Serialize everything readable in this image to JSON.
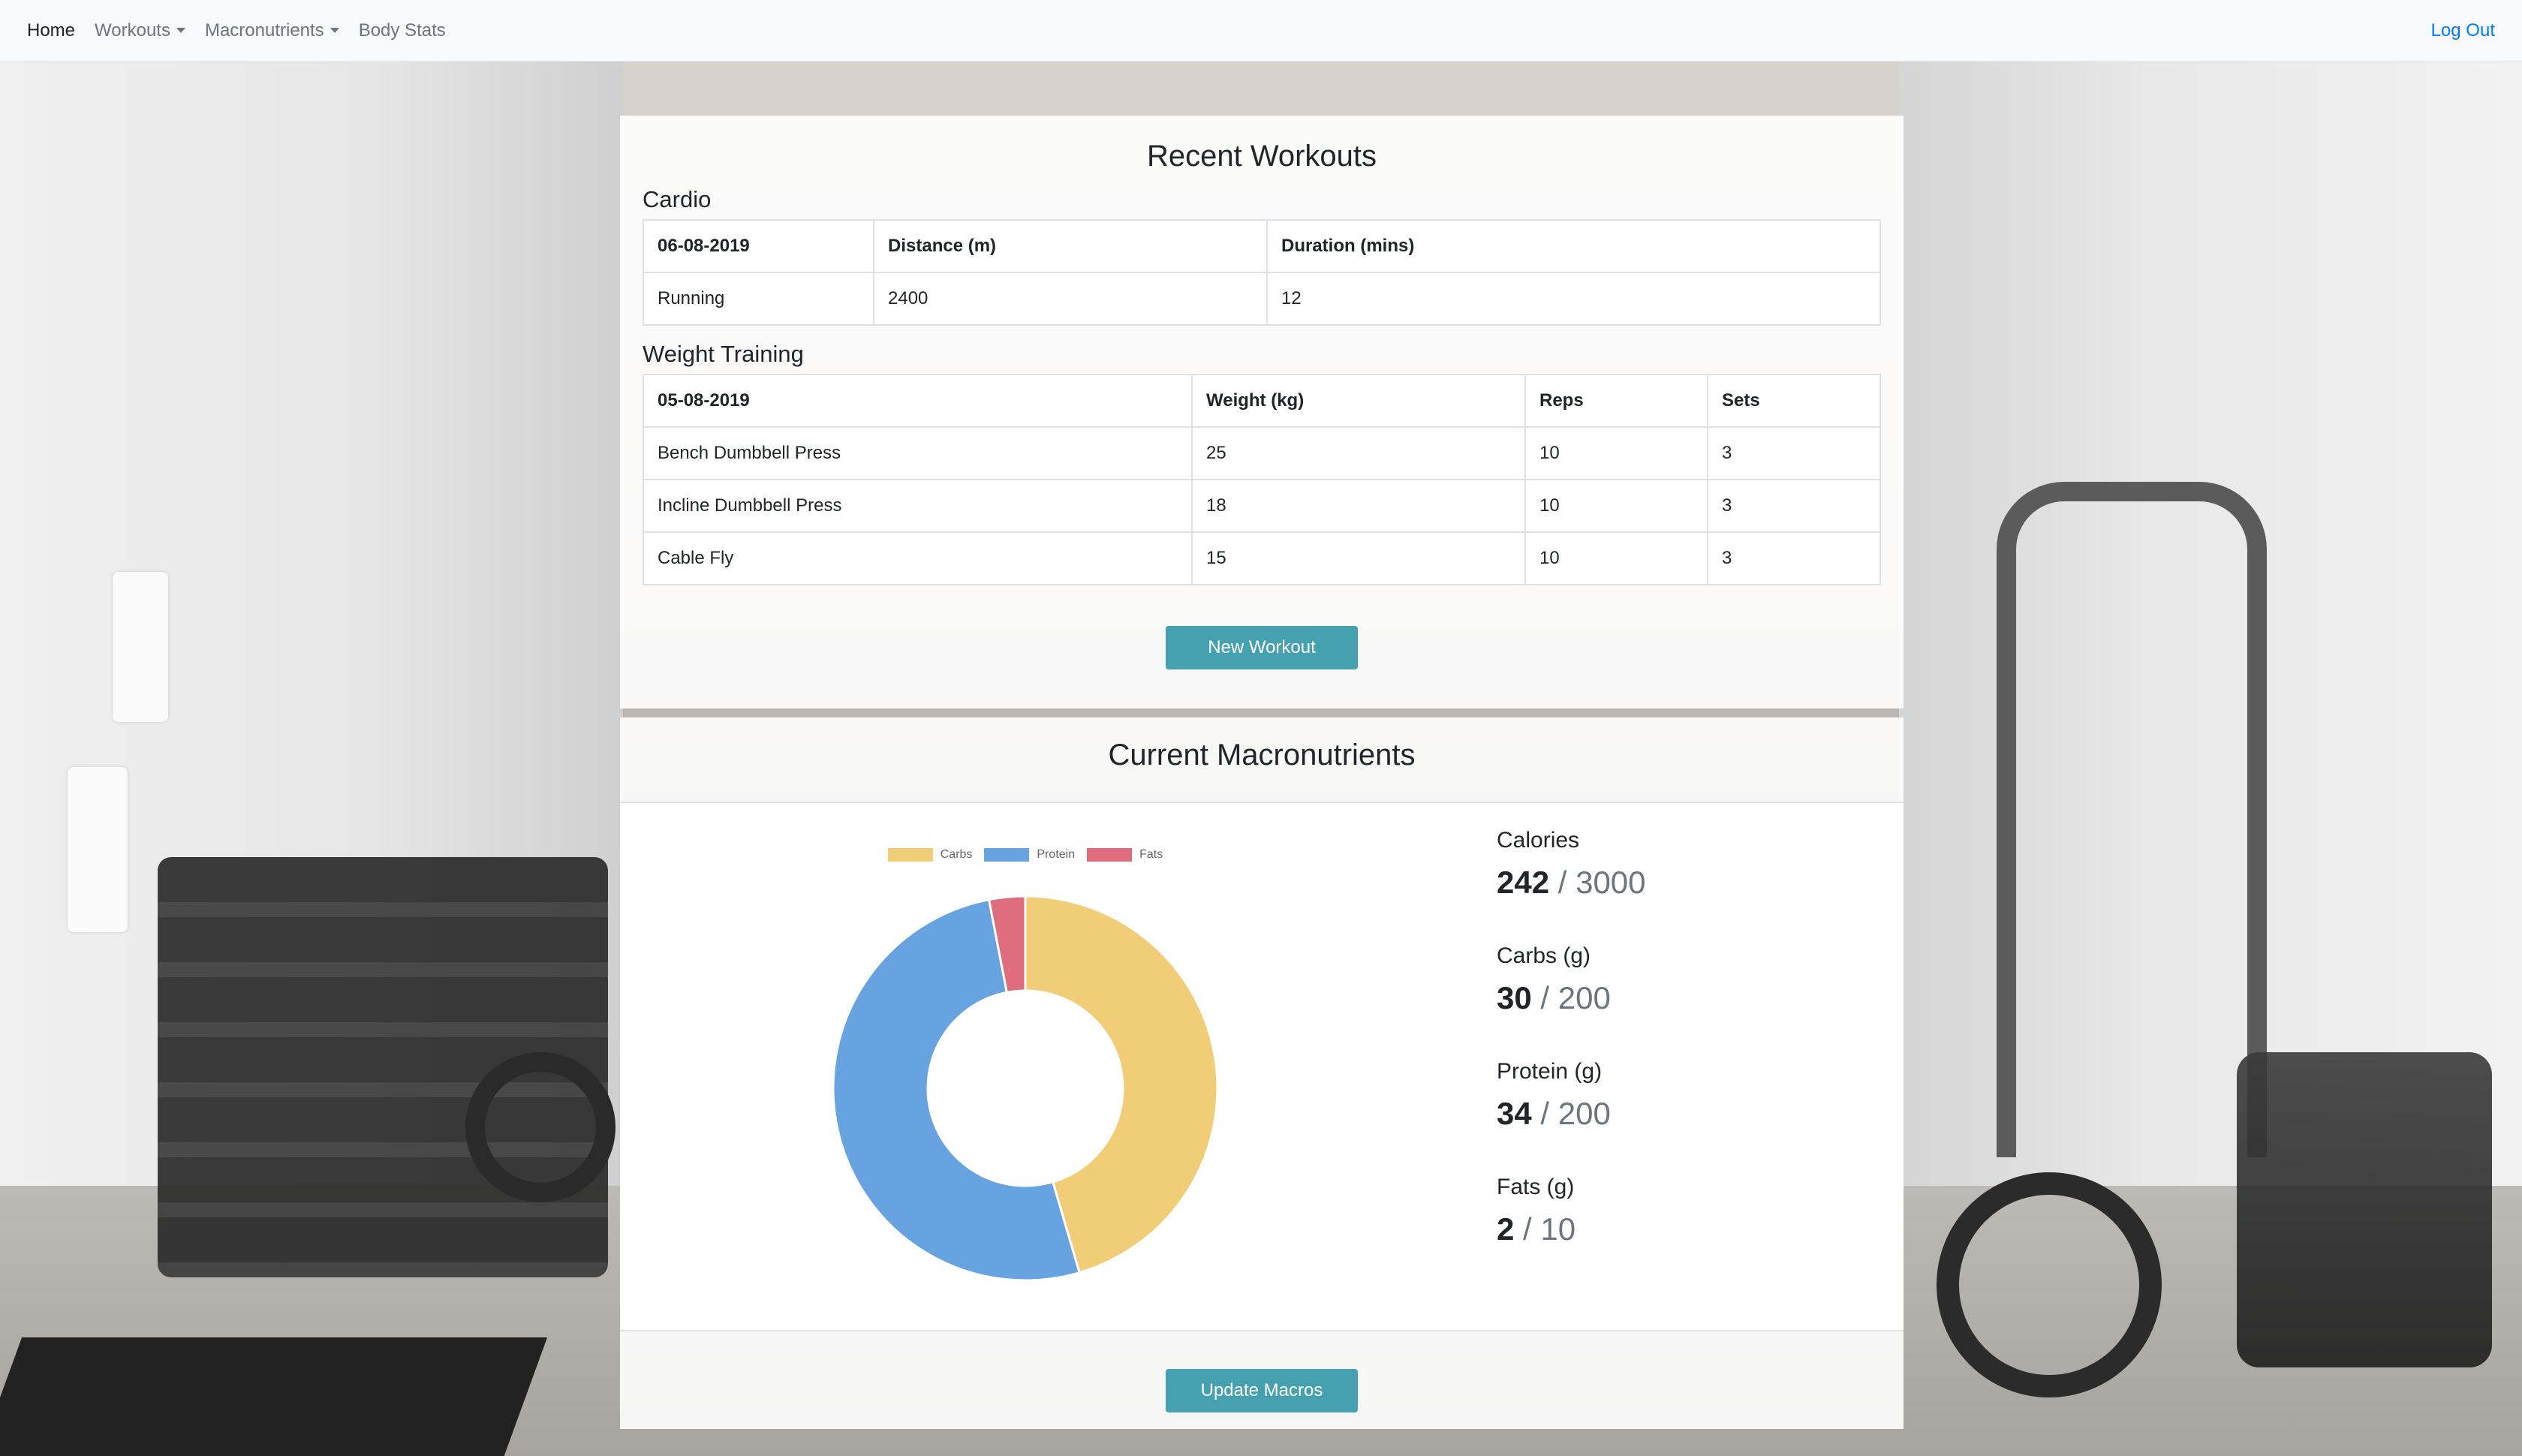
{
  "nav": {
    "home": "Home",
    "workouts": "Workouts",
    "macronutrients": "Macronutrients",
    "body_stats": "Body Stats",
    "logout": "Log Out"
  },
  "workouts": {
    "title": "Recent Workouts",
    "cardio": {
      "title": "Cardio",
      "headers": [
        "06-08-2019",
        "Distance (m)",
        "Duration (mins)"
      ],
      "rows": [
        [
          "Running",
          "2400",
          "12"
        ]
      ]
    },
    "weight": {
      "title": "Weight Training",
      "headers": [
        "05-08-2019",
        "Weight (kg)",
        "Reps",
        "Sets"
      ],
      "rows": [
        [
          "Bench Dumbbell Press",
          "25",
          "10",
          "3"
        ],
        [
          "Incline Dumbbell Press",
          "18",
          "10",
          "3"
        ],
        [
          "Cable Fly",
          "15",
          "10",
          "3"
        ]
      ]
    },
    "new_button": "New Workout"
  },
  "macros": {
    "title": "Current Macronutrients",
    "stats": [
      {
        "label": "Calories",
        "current": "242",
        "target": "3000"
      },
      {
        "label": "Carbs (g)",
        "current": "30",
        "target": "200"
      },
      {
        "label": "Protein (g)",
        "current": "34",
        "target": "200"
      },
      {
        "label": "Fats (g)",
        "current": "2",
        "target": "10"
      }
    ],
    "separator": "/",
    "update_button": "Update Macros"
  },
  "chart_data": {
    "type": "doughnut",
    "categories": [
      "Carbs",
      "Protein",
      "Fats"
    ],
    "values": [
      30,
      34,
      2
    ],
    "colors": [
      "#f2cd78",
      "#67a3e0",
      "#e06d7e"
    ],
    "legend": "top"
  }
}
